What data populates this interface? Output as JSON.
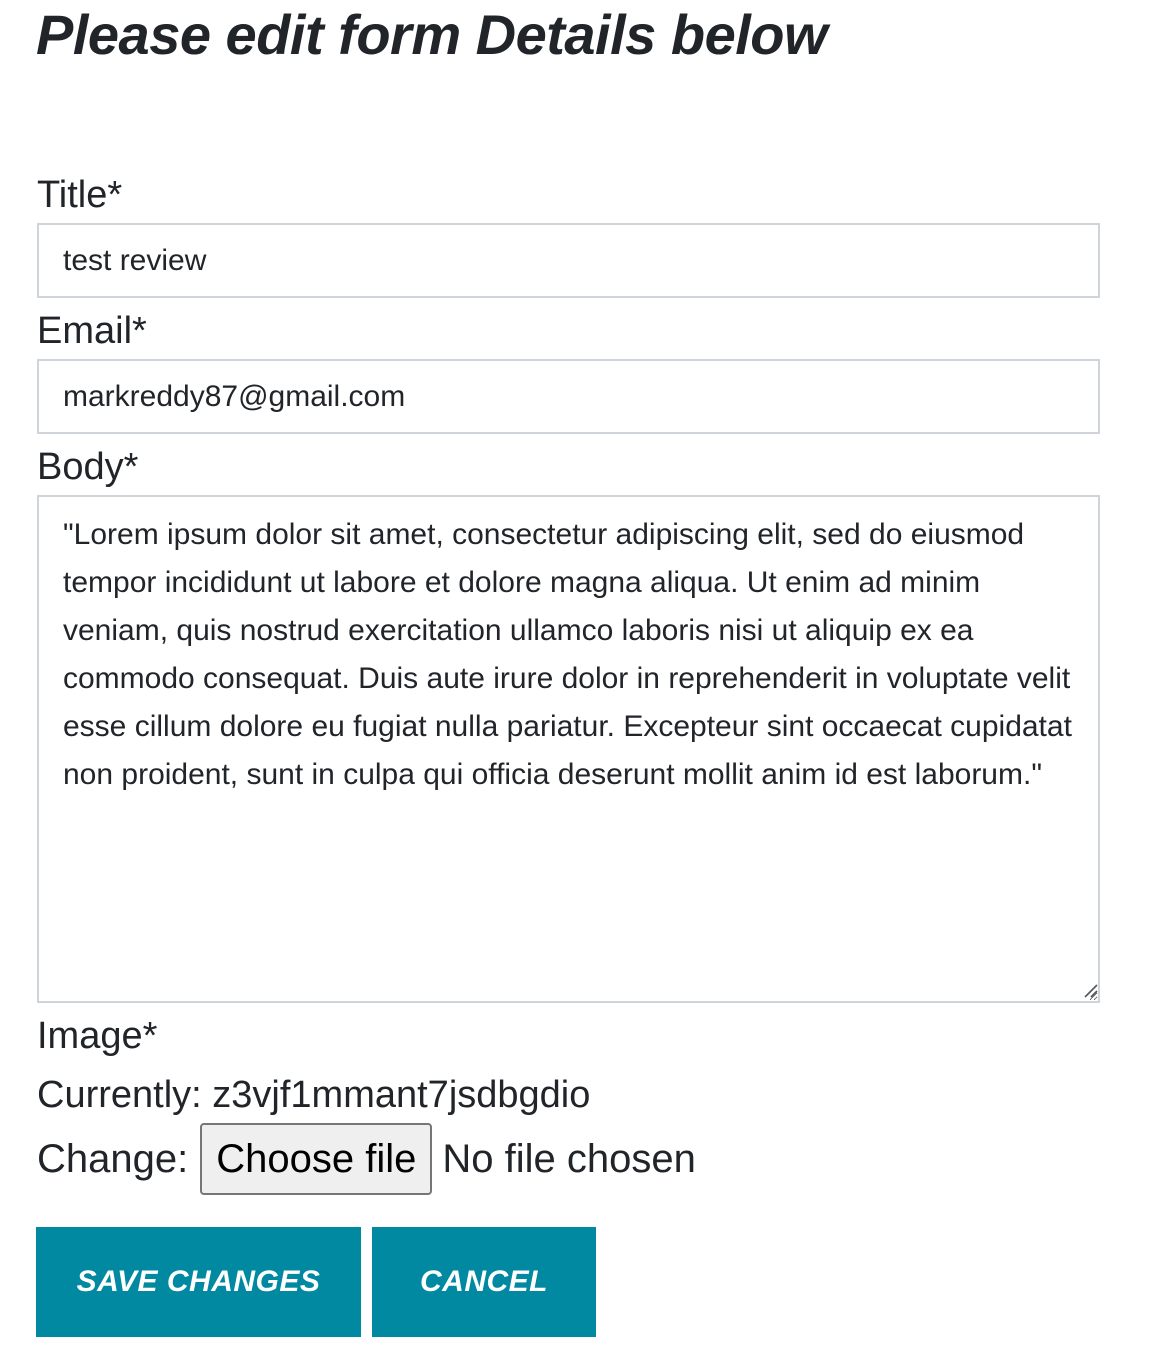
{
  "page": {
    "heading": "Please edit form Details below"
  },
  "form": {
    "title": {
      "label": "Title*",
      "value": "test review"
    },
    "email": {
      "label": "Email*",
      "value": "markreddy87@gmail.com"
    },
    "body": {
      "label": "Body*",
      "value": "\"Lorem ipsum dolor sit amet, consectetur adipiscing elit, sed do eiusmod tempor incididunt ut labore et dolore magna aliqua. Ut enim ad minim veniam, quis nostrud exercitation ullamco laboris nisi ut aliquip ex ea commodo consequat. Duis aute irure dolor in reprehenderit in voluptate velit esse cillum dolore eu fugiat nulla pariatur. Excepteur sint occaecat cupidatat non proident, sunt in culpa qui officia deserunt mollit anim id est laborum.\""
    },
    "image": {
      "label": "Image*",
      "currently_label": "Currently:",
      "currently_value": "z3vjf1mmant7jsdbgdio",
      "change_label": "Change:",
      "choose_button": "Choose file",
      "no_file_text": "No file chosen"
    }
  },
  "actions": {
    "save_label": "SAVE CHANGES",
    "cancel_label": "CANCEL"
  },
  "colors": {
    "accent": "#0089a1",
    "text": "#212529",
    "input_border": "#ced4da"
  }
}
